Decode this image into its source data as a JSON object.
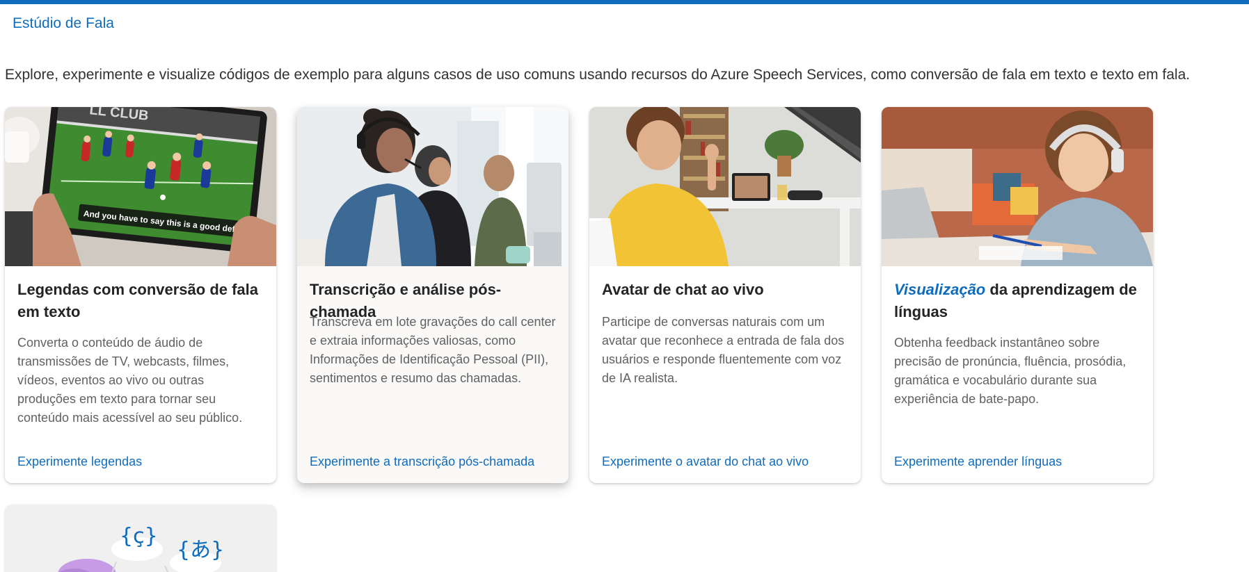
{
  "breadcrumb": {
    "label": "Estúdio de Fala"
  },
  "intro": "Explore, experimente e visualize códigos de exemplo para alguns casos de uso comuns usando recursos do Azure Speech Services, como conversão de fala em texto e texto em fala.",
  "colors": {
    "accent": "#0f6cbd",
    "text": "#323130",
    "muted": "#616161",
    "card_hover_bg": "#faf9f8"
  },
  "cards": [
    {
      "image": "tablet-soccer-with-captions",
      "image_caption": "And you have to say this is a good defense.",
      "image_sign": "LL CLUB",
      "title": "Legendas com conversão de fala em texto",
      "description": "Converta o conteúdo de áudio de transmissões de TV, webcasts, filmes, vídeos, eventos ao vivo ou outras produções em texto para tornar seu conteúdo mais acessível ao seu público.",
      "link": "Experimente legendas"
    },
    {
      "image": "call-center-agents",
      "title": "Transcrição e análise pós-chamada",
      "description": "Transcreva em lote gravações do call center e extraia informações valiosas, como Informações de Identificação Pessoal (PII), sentimentos e resumo das chamadas.",
      "link": "Experimente a transcrição pós-chamada",
      "hovered": true
    },
    {
      "image": "video-chat-waving",
      "title": "Avatar de chat ao vivo",
      "description": "Participe de conversas naturais com um avatar que reconhece a entrada de fala dos usuários e responde fluentemente com voz de IA realista.",
      "link": "Experimente o avatar do chat ao vivo"
    },
    {
      "image": "child-with-headphones-learning",
      "badge": "Visualização",
      "title_rest": "da aprendizagem de línguas",
      "description": "Obtenha feedback instantâneo sobre precisão de pronúncia, fluência, prosódia, gramática e vocabulário durante sua experiência de bate-papo.",
      "link": "Experimente aprender línguas"
    },
    {
      "image": "language-glyph-illustration",
      "glyph_1": "{ç}",
      "glyph_2": "{あ}"
    }
  ]
}
